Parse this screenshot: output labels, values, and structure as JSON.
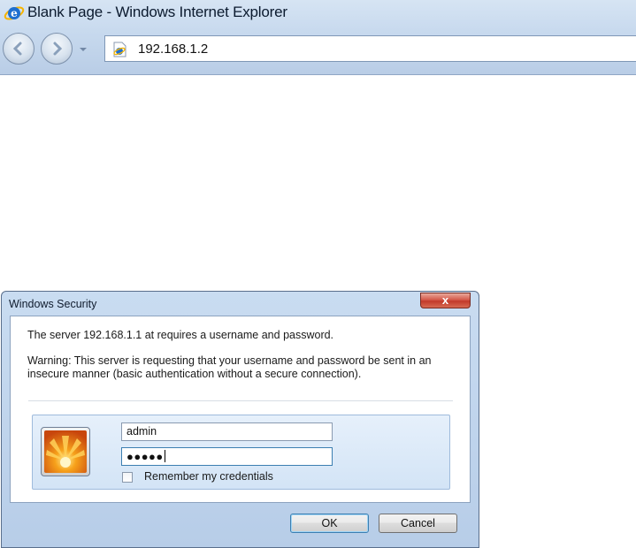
{
  "browser": {
    "window_title": "Blank Page - Windows Internet Explorer",
    "address": "192.168.1.2",
    "icons": [
      "ie-logo-icon",
      "back-arrow-icon",
      "forward-arrow-icon",
      "chevron-down-icon",
      "page-icon"
    ]
  },
  "dialog": {
    "title": "Windows Security",
    "close_label": "x",
    "message": "The server 192.168.1.1 at  requires a username and password.",
    "warning": "Warning: This server is requesting that your username and password be sent in an insecure manner (basic authentication without a secure connection).",
    "username_value": "admin",
    "password_mask": "●●●●●",
    "remember_label": "Remember my credentials",
    "remember_checked": false,
    "ok_label": "OK",
    "cancel_label": "Cancel",
    "icons": [
      "user-picture-icon"
    ]
  },
  "colors": {
    "chrome": "#c7d9ee",
    "dialog_frame": "#b7cde8",
    "close_button": "#c23a2a",
    "credential_tile": "#d3e4f6"
  }
}
